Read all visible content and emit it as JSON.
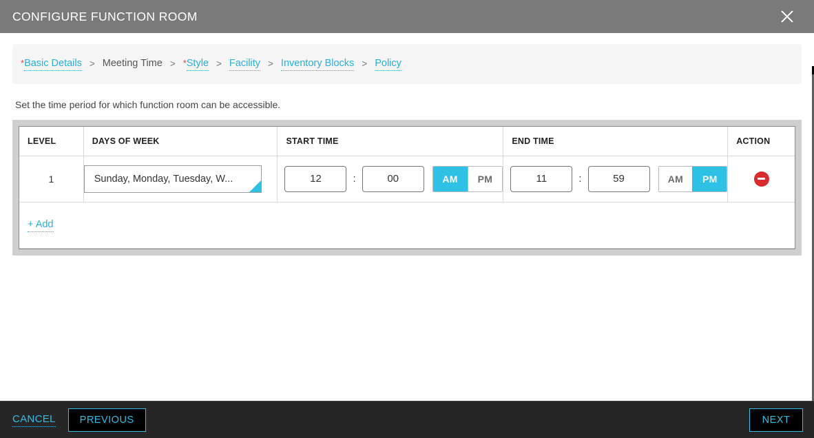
{
  "window": {
    "title": "CONFIGURE FUNCTION ROOM",
    "close_icon": "close-icon"
  },
  "breadcrumb": {
    "separator": ">",
    "required_marker": "*",
    "steps": [
      {
        "label": "Basic Details",
        "required": true,
        "state": "link"
      },
      {
        "label": "Meeting Time",
        "required": false,
        "state": "current"
      },
      {
        "label": "Style",
        "required": true,
        "state": "link"
      },
      {
        "label": "Facility",
        "required": false,
        "state": "link"
      },
      {
        "label": "Inventory Blocks",
        "required": false,
        "state": "link"
      },
      {
        "label": "Policy",
        "required": false,
        "state": "link"
      }
    ]
  },
  "main": {
    "description": "Set the time period for which function room can be accessible.",
    "table": {
      "headers": [
        "LEVEL",
        "DAYS OF WEEK",
        "START TIME",
        "END TIME",
        "ACTION"
      ],
      "rows": [
        {
          "level": "1",
          "days_of_week": "Sunday, Monday, Tuesday, W...",
          "start_hour": "12",
          "start_minute": "00",
          "start_meridiem": "AM",
          "end_hour": "11",
          "end_minute": "59",
          "end_meridiem": "PM",
          "time_separator": ":",
          "meridiem_options": [
            "AM",
            "PM"
          ],
          "action_icon": "remove-circle-icon"
        }
      ],
      "add_label": "+ Add"
    }
  },
  "footer": {
    "cancel_label": "CANCEL",
    "previous_label": "PREVIOUS",
    "next_label": "NEXT"
  },
  "colors": {
    "accent": "#2ec1e6",
    "link": "#27b0d8",
    "required": "#e8413c",
    "titlebar": "#7a7a7a",
    "footer": "#262626",
    "panel": "#cfcfcf",
    "danger": "#d92b2b"
  }
}
